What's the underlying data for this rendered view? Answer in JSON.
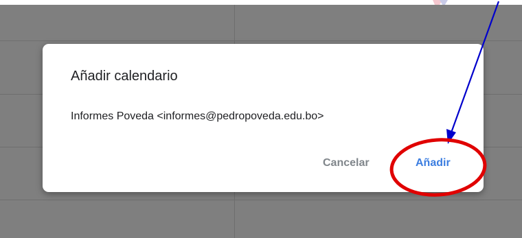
{
  "dialog": {
    "title": "Añadir calendario",
    "body": "Informes Poveda <informes@pedropoveda.edu.bo>",
    "cancel_label": "Cancelar",
    "add_label": "Añadir"
  },
  "colors": {
    "backdrop": "#7f7f7f",
    "add_button": "#3b7de0",
    "cancel_button": "#80868b",
    "annotation_arrow": "#0000cc",
    "annotation_circle": "#e00000"
  }
}
